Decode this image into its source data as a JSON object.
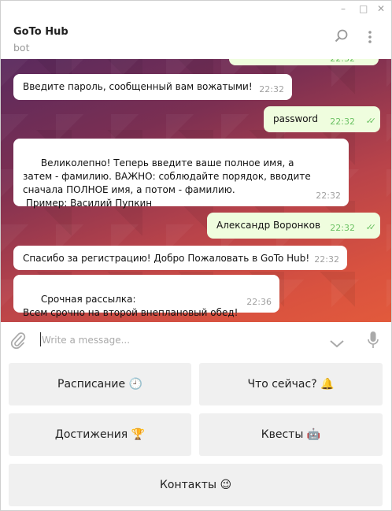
{
  "window": {
    "controls": [
      "–",
      "□",
      "✕"
    ]
  },
  "header": {
    "title": "GoTo Hub",
    "subtitle": "bot"
  },
  "messages": [
    {
      "text": "Введите пароль, сообщенный вам вожатыми!",
      "time": "22:32",
      "direction": "in"
    },
    {
      "text": "password",
      "time": "22:32",
      "direction": "out"
    },
    {
      "text": "Великолепно! Теперь введите ваше полное имя, а затем - фамилию. ВАЖНО: соблюдайте порядок, вводите сначала ПОЛНОЕ имя, а потом - фамилию.\n Пример: Василий Пупкин",
      "time": "22:32",
      "direction": "in"
    },
    {
      "text": "Александр Воронков",
      "time": "22:32",
      "direction": "out"
    },
    {
      "text": "Спасибо за регистрацию! Добро Пожаловать в GoTo Hub!",
      "time": "22:32",
      "direction": "in"
    },
    {
      "text": "Срочная рассылка:\nВсем срочно на второй внеплановый обед!",
      "time": "22:36",
      "direction": "in"
    }
  ],
  "partial_top_message": {
    "time": "22:32"
  },
  "composer": {
    "placeholder": "Write a message..."
  },
  "keyboard": {
    "schedule": "Расписание 🕘",
    "now": "Что сейчас? 🔔",
    "achievements": "Достижения 🏆",
    "quests": "Квесты 🤖",
    "contacts": "Контакты 😉"
  },
  "colors": {
    "incoming": "#ffffff",
    "outgoing": "#effdde",
    "check": "#6cc264"
  }
}
